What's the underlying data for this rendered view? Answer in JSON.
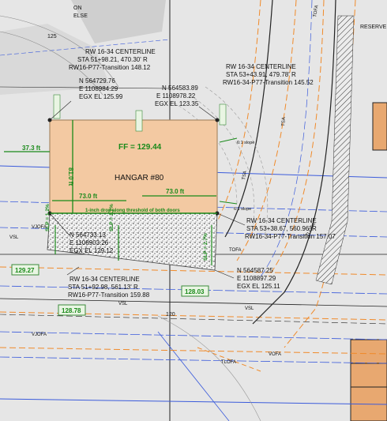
{
  "colors": {
    "background": "#e6e6e6",
    "hangar_fill": "#f3c9a2",
    "hangar_outline": "#a98a66",
    "green_annotation": "#1a8a1a",
    "blue_line": "#3b5bdb",
    "orange_line": "#f08a2a",
    "dark_line": "#222222"
  },
  "callouts": {
    "nw_centerline": {
      "l1": "RW 16-34 CENTERLINE",
      "l2": "STA 51+98.21, 470.30' R",
      "l3": "RW16-P77-Transition 148.12"
    },
    "ne_centerline": {
      "l1": "RW 16-34 CENTERLINE",
      "l2": "STA 53+43.91, 479.78' R",
      "l3": "RW16-34-P77-Transition 145.52"
    },
    "se_centerline": {
      "l1": "RW 16-34 CENTERLINE",
      "l2": "STA 53+38.67, 560.96' R",
      "l3": "RW16-34-P77-Transition 157.07"
    },
    "sw_centerline": {
      "l1": "RW 16-34 CENTERLINE",
      "l2": "STA 51+92.98, 561.13' R",
      "l3": "RW16-P77-Transition 159.88"
    }
  },
  "coordinates": {
    "nw": {
      "n": "N 564729.76",
      "e": "E 1108984.29",
      "el": "EGX EL 125.99"
    },
    "ne": {
      "n": "N 564583.89",
      "e": "E 1108978.22",
      "el": "EGX EL 123.35"
    },
    "sw": {
      "n": "N 564733.13",
      "e": "E 1108903.26",
      "el": "EGX EL 129.12"
    },
    "se": {
      "n": "N 564587.25",
      "e": "E 1108897.29",
      "el": "EGX EL 125.11"
    }
  },
  "hangar": {
    "label": "HANGAR #80",
    "ff": "FF = 129.44",
    "width_left": "73.0 ft",
    "width_right": "73.0 ft",
    "depth": "81.0 ft",
    "setback": "37.3 ft",
    "threshold_note": "1-inch drop along threshold of both doors"
  },
  "slopes": {
    "s1": "SLP = 1.2%",
    "s2": "SLP = 1.2%",
    "s3": "SLP = 2.7%",
    "upper": "6:1 slope",
    "lower": "6:1 slope"
  },
  "spot_elevations": {
    "a": "129.27",
    "b": "128.03",
    "c": "128.78"
  },
  "map_labels": {
    "top_left_a": "ON",
    "top_left_b": "ELSE",
    "top_right": "RESERVE"
  },
  "contour_labels": {
    "c1": "125",
    "c2": "120"
  },
  "linetype_labels": {
    "tofa": "TOFA",
    "tsa": "TSA",
    "tlofa": "TLOFA",
    "vsl": "VSL",
    "vofa": "VOFA",
    "vjofa": "VJOFA"
  }
}
